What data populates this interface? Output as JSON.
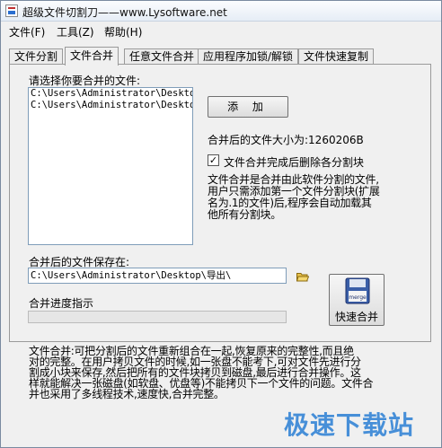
{
  "window": {
    "title": "超级文件切割刀——www.Lysoftware.net"
  },
  "menu": {
    "file": "文件(F)",
    "tools": "工具(Z)",
    "help": "帮助(H)"
  },
  "tabs": [
    {
      "label": "文件分割",
      "active": false
    },
    {
      "label": "文件合并",
      "active": true
    },
    {
      "label": "任意文件合并",
      "active": false
    },
    {
      "label": "应用程序加锁/解锁",
      "active": false
    },
    {
      "label": "文件快速复制",
      "active": false
    }
  ],
  "merge": {
    "select_label": "请选择你要合并的文件:",
    "file_list": [
      "C:\\Users\\Administrator\\Desktop",
      "C:\\Users\\Administrator\\Desktop"
    ],
    "add_button": "添 加",
    "size_text": "合并后的文件大小为:1260206B",
    "delete_checkbox_label": "文件合并完成后删除各分割块",
    "delete_checked": true,
    "description": "文件合并是合并由此软件分割的文件,\n用户只需添加第一个文件分割块(扩展\n名为.1的文件)后,程序会自动加载其\n他所有分割块。",
    "save_label": "合并后的文件保存在:",
    "save_path": "C:\\Users\\Administrator\\Desktop\\导出\\",
    "progress_label": "合并进度指示",
    "progress": 0,
    "fast_merge_button": "快速合并",
    "merge_icon_text": "merge"
  },
  "footer_description": "文件合并:可把分割后的文件重新组合在一起,恢复原来的完整性,而且绝\n对的完整。在用户拷贝文件的时候,如一张盘不能考下,可对文件先进行分\n割成小块来保存,然后把所有的文件块拷贝到磁盘,最后进行合并操作。这\n样就能解决一张磁盘(如软盘、优盘等)不能拷贝下一个文件的问题。文件合\n并也采用了多线程技术,速度快,合并完整。",
  "watermark": "极速下载站"
}
